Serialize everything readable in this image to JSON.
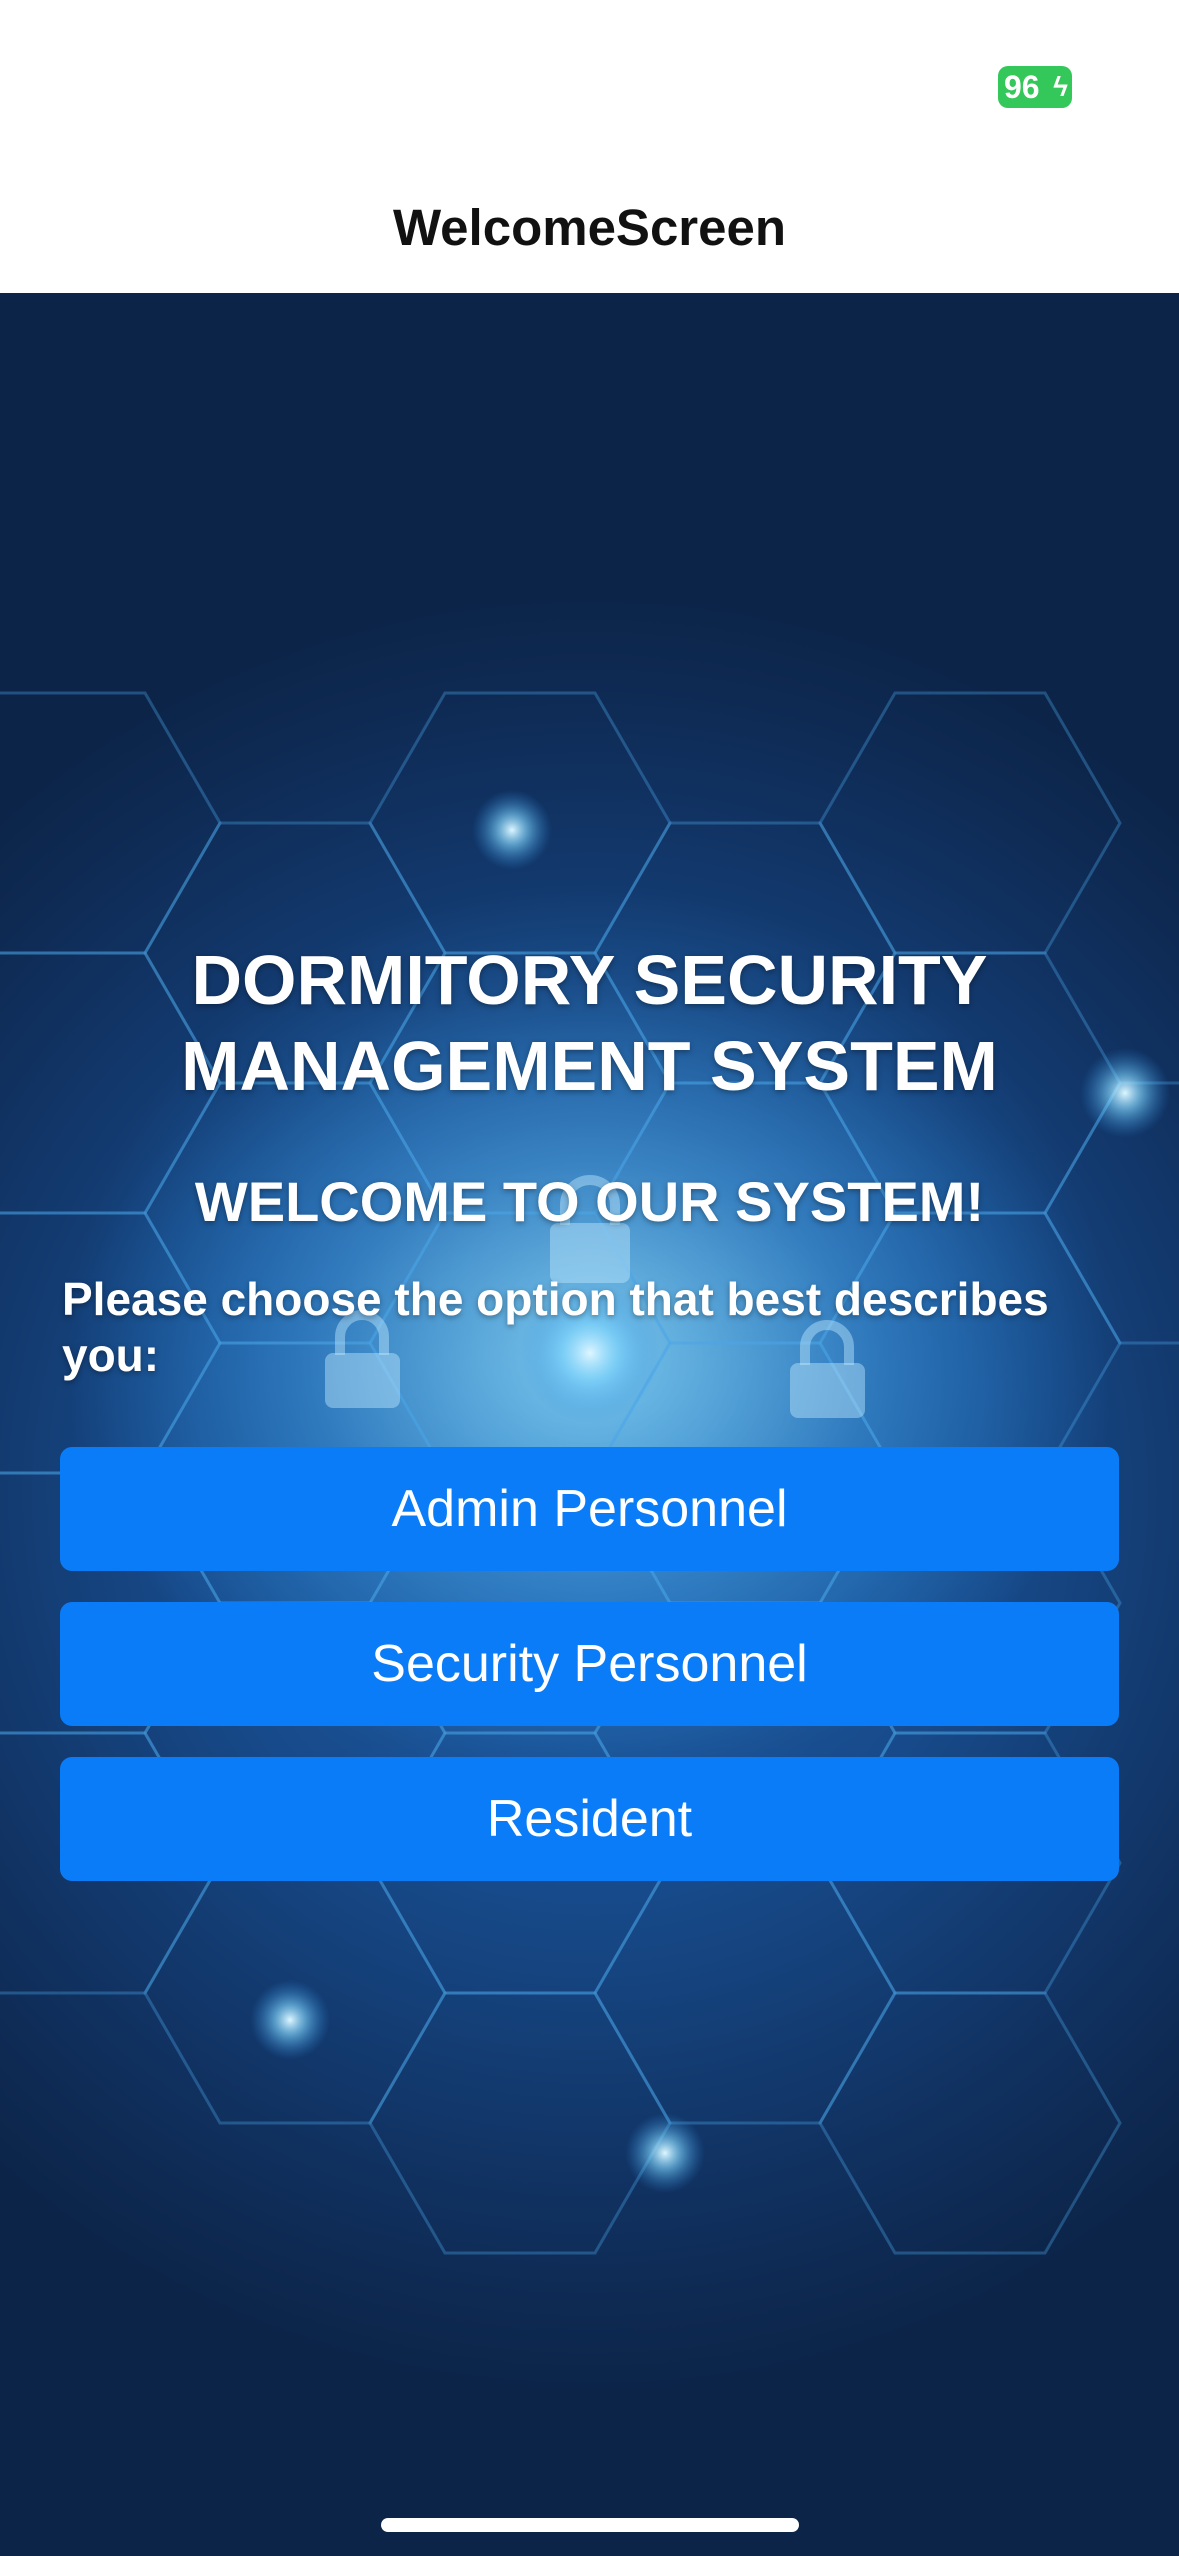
{
  "status_bar": {
    "battery_level": "96",
    "battery_color": "#34c759"
  },
  "header": {
    "title": "WelcomeScreen"
  },
  "main": {
    "title_line1": "DORMITORY SECURITY",
    "title_line2": "MANAGEMENT SYSTEM",
    "welcome": "WELCOME TO OUR SYSTEM!",
    "prompt": "Please choose the option that best describes you:",
    "options": [
      {
        "label": "Admin Personnel"
      },
      {
        "label": "Security Personnel"
      },
      {
        "label": "Resident"
      }
    ],
    "button_color": "#0b7cf7"
  }
}
